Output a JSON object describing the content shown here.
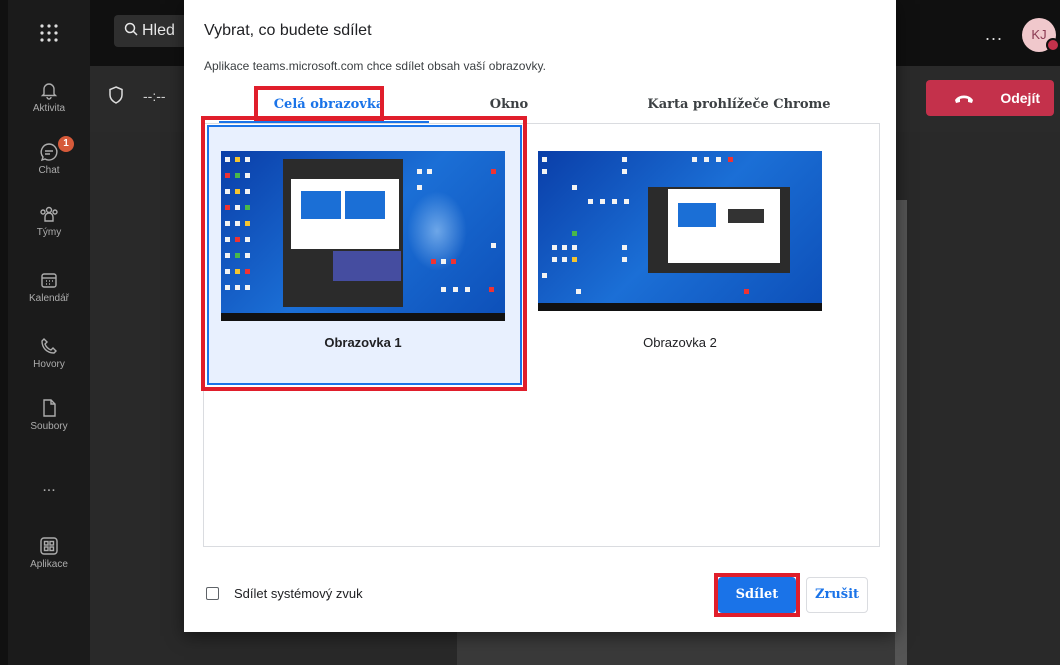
{
  "teams": {
    "search_text": "Hled",
    "timer": "--:--",
    "more": "...",
    "avatar_initials": "KJ",
    "leave_label": "Odejít",
    "rail": [
      {
        "label": "Aktivita",
        "icon": "bell-icon"
      },
      {
        "label": "Chat",
        "icon": "chat-icon",
        "badge": "1"
      },
      {
        "label": "Týmy",
        "icon": "teams-icon"
      },
      {
        "label": "Kalendář",
        "icon": "calendar-icon"
      },
      {
        "label": "Hovory",
        "icon": "phone-icon"
      },
      {
        "label": "Soubory",
        "icon": "file-icon"
      },
      {
        "label": "...",
        "icon": "more-icon"
      },
      {
        "label": "Aplikace",
        "icon": "apps-icon"
      }
    ]
  },
  "dialog": {
    "title": "Vybrat, co budete sdílet",
    "subtitle": "Aplikace teams.microsoft.com chce sdílet obsah vaší obrazovky.",
    "tabs": [
      {
        "label": "Celá obrazovka",
        "active": true
      },
      {
        "label": "Okno",
        "active": false
      },
      {
        "label": "Karta prohlížeče Chrome",
        "active": false
      }
    ],
    "screens": [
      {
        "label": "Obrazovka 1",
        "selected": true
      },
      {
        "label": "Obrazovka 2",
        "selected": false
      }
    ],
    "system_audio_label": "Sdílet systémový zvuk",
    "share_label": "Sdílet",
    "cancel_label": "Zrušit"
  },
  "colors": {
    "accent": "#1a73e8",
    "highlight": "#e01e2b",
    "leave": "#c4314b"
  }
}
